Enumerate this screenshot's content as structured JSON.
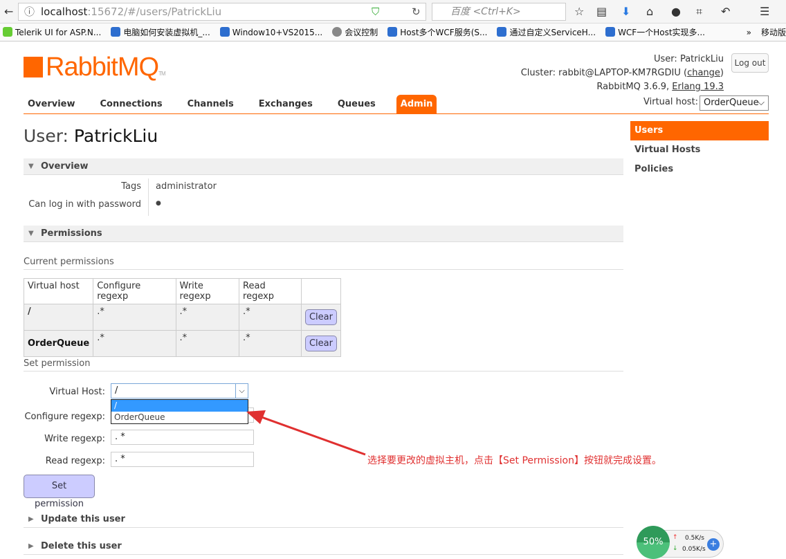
{
  "browser": {
    "url_host": "localhost",
    "url_rest": ":15672/#/users/PatrickLiu",
    "search_placeholder": "百度 <Ctrl+K>",
    "bookmarks": [
      "Telerik UI for ASP.N...",
      "电脑如何安装虚拟机_...",
      "Window10+VS2015...",
      "会议控制",
      "Host多个WCF服务(S...",
      "通过自定义ServiceH...",
      "WCF一个Host实现多..."
    ],
    "more": "»",
    "mobile": "移动版"
  },
  "header": {
    "logo": "RabbitMQ",
    "user_label": "User:",
    "user": "PatrickLiu",
    "cluster_label": "Cluster:",
    "cluster": "rabbit@LAPTOP-KM7RGDIU",
    "change": "change",
    "version": "RabbitMQ 3.6.9,",
    "erlang": "Erlang 19.3",
    "logout": "Log out"
  },
  "nav": {
    "tabs": [
      "Overview",
      "Connections",
      "Channels",
      "Exchanges",
      "Queues",
      "Admin"
    ],
    "vhost_label": "Virtual host:",
    "vhost_value": "OrderQueue"
  },
  "sidebar": [
    "Users",
    "Virtual Hosts",
    "Policies"
  ],
  "page": {
    "title_prefix": "User:",
    "title_name": "PatrickLiu"
  },
  "overview": {
    "heading": "Overview",
    "tags_label": "Tags",
    "tags": "administrator",
    "login_label": "Can log in with password",
    "login_value": "●"
  },
  "permissions": {
    "heading": "Permissions",
    "current": "Current permissions",
    "columns": [
      "Virtual host",
      "Configure regexp",
      "Write regexp",
      "Read regexp"
    ],
    "rows": [
      {
        "vhost": "/",
        "configure": ".*",
        "write": ".*",
        "read": ".*",
        "action": "Clear"
      },
      {
        "vhost": "OrderQueue",
        "configure": ".*",
        "write": ".*",
        "read": ".*",
        "action": "Clear"
      }
    ],
    "set_heading": "Set permission",
    "form": {
      "vhost_label": "Virtual Host:",
      "vhost_value": "/",
      "options": [
        "/",
        "OrderQueue"
      ],
      "configure_label": "Configure regexp:",
      "write_label": "Write regexp:",
      "write_value": ". *",
      "read_label": "Read regexp:",
      "read_value": ". *",
      "submit": "Set permission"
    }
  },
  "annotation": "选择要更改的虚拟主机，点击【Set Permission】按钮就完成设置。",
  "collapsed": [
    "Update this user",
    "Delete this user"
  ],
  "widget": {
    "percent": "50%",
    "up": "0.5K/s",
    "down": "0.05K/s"
  },
  "colors": {
    "accent": "#ff6600",
    "button": "#ccccff",
    "annotation": "#e03030"
  }
}
